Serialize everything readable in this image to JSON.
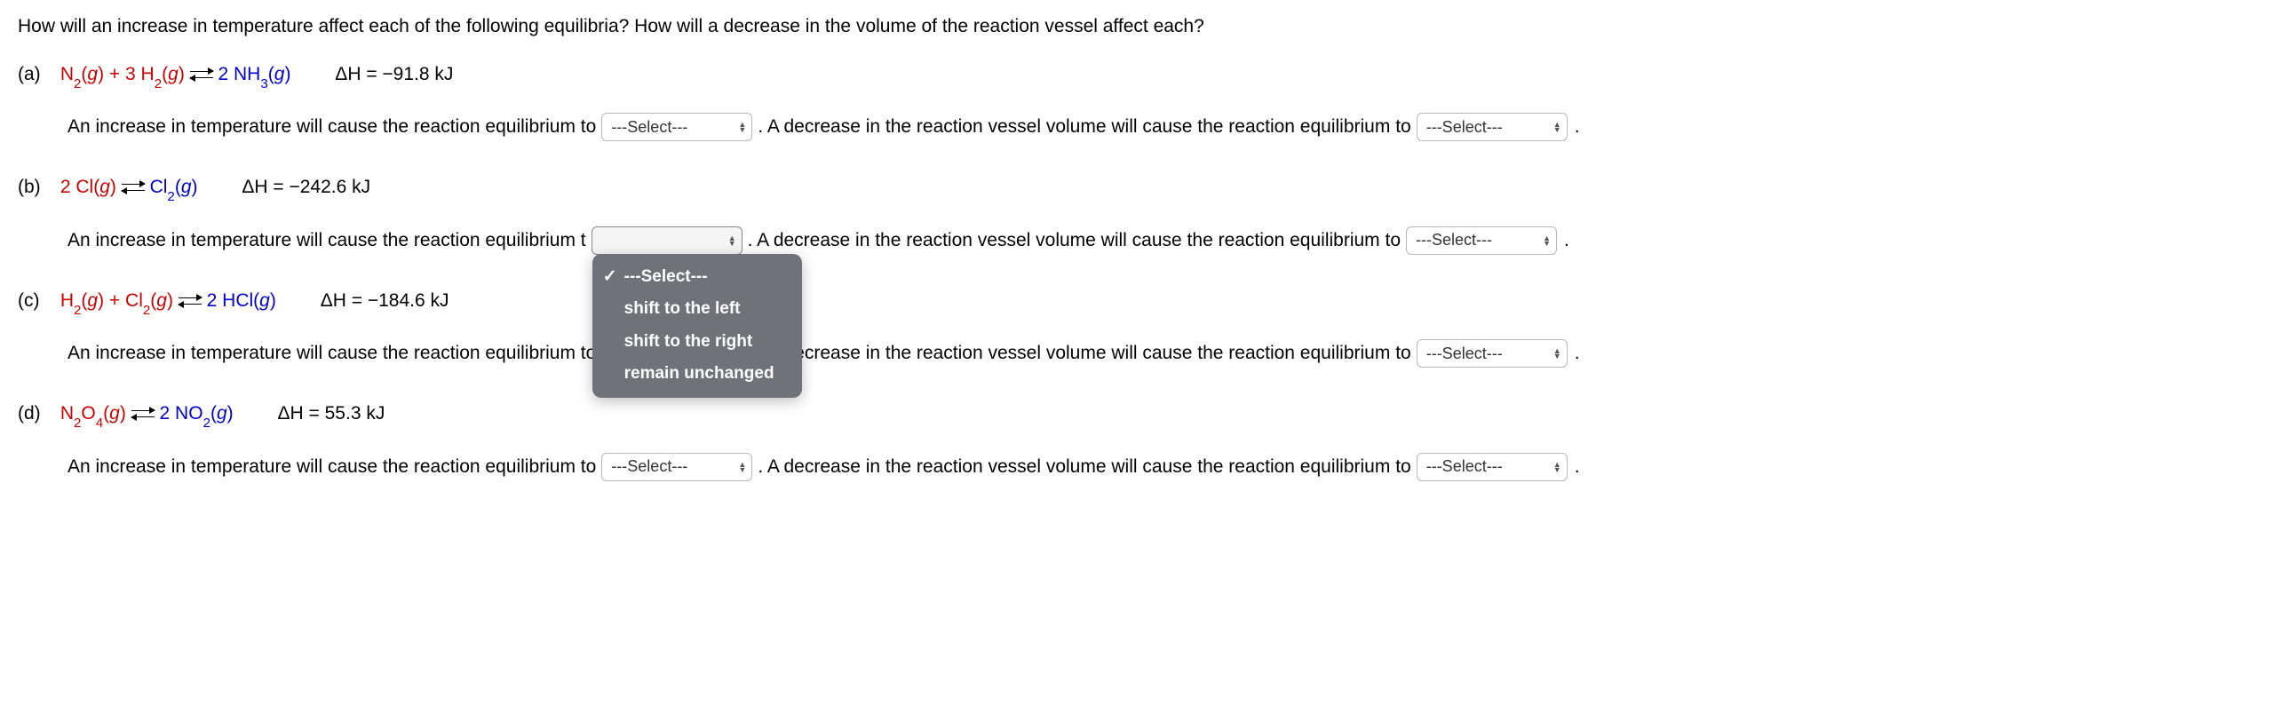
{
  "intro": "How will an increase in temperature affect each of the following equilibria? How will a decrease in the volume of the reaction vessel affect each?",
  "select_placeholder": "---Select---",
  "dropdown_options": {
    "opt0": "---Select---",
    "opt1": "shift to the left",
    "opt2": "shift to the right",
    "opt3": "remain unchanged"
  },
  "prompt_temp": "An increase in temperature will cause the reaction equilibrium to",
  "prompt_temp_trunc": "An increase in temperature will cause the reaction equilibrium t",
  "prompt_vol": ". A decrease in the reaction vessel volume will cause the reaction equilibrium to",
  "parts": {
    "a": {
      "label": "(a)",
      "lhs_html": "N<sub>2</sub>(<span class=\"gstate\">g</span>) + 3 H<sub>2</sub>(<span class=\"gstate\">g</span>)",
      "rhs_html": "2 NH<sub>3</sub>(<span class=\"gstate\">g</span>)",
      "dH": "ΔH = −91.8 kJ"
    },
    "b": {
      "label": "(b)",
      "lhs_html": "2 Cl(<span class=\"gstate\">g</span>)",
      "rhs_html": "Cl<sub>2</sub>(<span class=\"gstate\">g</span>)",
      "dH": "ΔH = −242.6 kJ"
    },
    "c": {
      "label": "(c)",
      "lhs_html": "H<sub>2</sub>(<span class=\"gstate\">g</span>) + Cl<sub>2</sub>(<span class=\"gstate\">g</span>)",
      "rhs_html": "2 HCl(<span class=\"gstate\">g</span>)",
      "dH": "ΔH = −184.6 kJ"
    },
    "d": {
      "label": "(d)",
      "lhs_html": "N<sub>2</sub>O<sub>4</sub>(<span class=\"gstate\">g</span>)",
      "rhs_html": "2 NO<sub>2</sub>(<span class=\"gstate\">g</span>)",
      "dH": "ΔH = 55.3 kJ"
    }
  }
}
